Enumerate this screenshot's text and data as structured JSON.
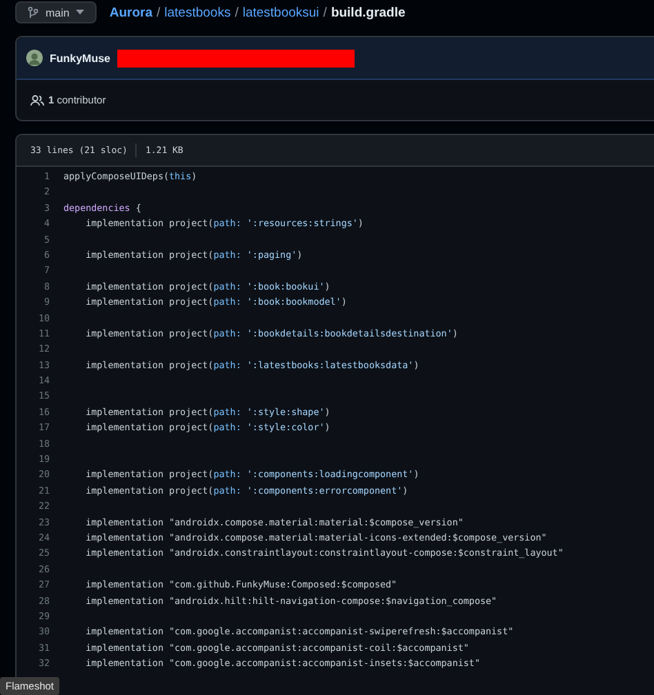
{
  "branch": {
    "label": "main"
  },
  "breadcrumb": [
    {
      "label": "Aurora",
      "kind": "repo"
    },
    {
      "label": "/",
      "kind": "separator"
    },
    {
      "label": "latestbooks",
      "kind": "dir"
    },
    {
      "label": "/",
      "kind": "separator"
    },
    {
      "label": "latestbooksui",
      "kind": "dir"
    },
    {
      "label": "/",
      "kind": "separator"
    },
    {
      "label": "build.gradle",
      "kind": "file"
    }
  ],
  "commit": {
    "author": "FunkyMuse"
  },
  "contributors": {
    "text": "**1** contributor"
  },
  "file_info": {
    "lines": "33 lines (21 sloc)",
    "size": "1.21 KB"
  },
  "code": [
    {
      "number": "1",
      "tokens": [
        {
          "t": "applyComposeUIDeps(",
          "kind": "plain"
        },
        {
          "t": "this",
          "kind": "keyword"
        },
        {
          "t": ")",
          "kind": "plain"
        }
      ]
    },
    {
      "number": "2"
    },
    {
      "number": "3",
      "tokens": [
        {
          "t": "dependencies",
          "kind": "entity"
        },
        {
          "t": " {",
          "kind": "plain"
        }
      ]
    },
    {
      "number": "4",
      "tokens": [
        {
          "t": "    implementation project(",
          "kind": "plain"
        },
        {
          "t": "path:",
          "kind": "keyword"
        },
        {
          "t": " ':resources:strings'",
          "kind": "string"
        },
        {
          "t": ")",
          "kind": "plain"
        }
      ]
    },
    {
      "number": "5"
    },
    {
      "number": "6",
      "tokens": [
        {
          "t": "    implementation project(",
          "kind": "plain"
        },
        {
          "t": "path:",
          "kind": "keyword"
        },
        {
          "t": " ':paging'",
          "kind": "string"
        },
        {
          "t": ")",
          "kind": "plain"
        }
      ]
    },
    {
      "number": "7"
    },
    {
      "number": "8",
      "tokens": [
        {
          "t": "    implementation project(",
          "kind": "plain"
        },
        {
          "t": "path:",
          "kind": "keyword"
        },
        {
          "t": " ':book:bookui'",
          "kind": "string"
        },
        {
          "t": ")",
          "kind": "plain"
        }
      ]
    },
    {
      "number": "9",
      "tokens": [
        {
          "t": "    implementation project(",
          "kind": "plain"
        },
        {
          "t": "path:",
          "kind": "keyword"
        },
        {
          "t": " ':book:bookmodel'",
          "kind": "string"
        },
        {
          "t": ")",
          "kind": "plain"
        }
      ]
    },
    {
      "number": "10"
    },
    {
      "number": "11",
      "tokens": [
        {
          "t": "    implementation project(",
          "kind": "plain"
        },
        {
          "t": "path:",
          "kind": "keyword"
        },
        {
          "t": " ':bookdetails:bookdetailsdestination'",
          "kind": "string"
        },
        {
          "t": ")",
          "kind": "plain"
        }
      ]
    },
    {
      "number": "12"
    },
    {
      "number": "13",
      "tokens": [
        {
          "t": "    implementation project(",
          "kind": "plain"
        },
        {
          "t": "path:",
          "kind": "keyword"
        },
        {
          "t": " ':latestbooks:latestbooksdata'",
          "kind": "string"
        },
        {
          "t": ")",
          "kind": "plain"
        }
      ]
    },
    {
      "number": "14"
    },
    {
      "number": "15"
    },
    {
      "number": "16",
      "tokens": [
        {
          "t": "    implementation project(",
          "kind": "plain"
        },
        {
          "t": "path:",
          "kind": "keyword"
        },
        {
          "t": " ':style:shape'",
          "kind": "string"
        },
        {
          "t": ")",
          "kind": "plain"
        }
      ]
    },
    {
      "number": "17",
      "tokens": [
        {
          "t": "    implementation project(",
          "kind": "plain"
        },
        {
          "t": "path:",
          "kind": "keyword"
        },
        {
          "t": " ':style:color'",
          "kind": "string"
        },
        {
          "t": ")",
          "kind": "plain"
        }
      ]
    },
    {
      "number": "18"
    },
    {
      "number": "19"
    },
    {
      "number": "20",
      "tokens": [
        {
          "t": "    implementation project(",
          "kind": "plain"
        },
        {
          "t": "path:",
          "kind": "keyword"
        },
        {
          "t": " ':components:loadingcomponent'",
          "kind": "string"
        },
        {
          "t": ")",
          "kind": "plain"
        }
      ]
    },
    {
      "number": "21",
      "tokens": [
        {
          "t": "    implementation project(",
          "kind": "plain"
        },
        {
          "t": "path:",
          "kind": "keyword"
        },
        {
          "t": " ':components:errorcomponent'",
          "kind": "string"
        },
        {
          "t": ")",
          "kind": "plain"
        }
      ]
    },
    {
      "number": "22"
    },
    {
      "number": "23",
      "tokens": [
        {
          "t": "    implementation \"androidx.compose.material:material:$compose_version\"",
          "kind": "plain"
        }
      ]
    },
    {
      "number": "24",
      "tokens": [
        {
          "t": "    implementation \"androidx.compose.material:material-icons-extended:$compose_version\"",
          "kind": "plain"
        }
      ]
    },
    {
      "number": "25",
      "tokens": [
        {
          "t": "    implementation \"androidx.constraintlayout:constraintlayout-compose:$constraint_layout\"",
          "kind": "plain"
        }
      ]
    },
    {
      "number": "26"
    },
    {
      "number": "27",
      "tokens": [
        {
          "t": "    implementation \"com.github.FunkyMuse:Composed:$composed\"",
          "kind": "plain"
        }
      ]
    },
    {
      "number": "28",
      "tokens": [
        {
          "t": "    implementation \"androidx.hilt:hilt-navigation-compose:$navigation_compose\"",
          "kind": "plain"
        }
      ]
    },
    {
      "number": "29"
    },
    {
      "number": "30",
      "tokens": [
        {
          "t": "    implementation \"com.google.accompanist:accompanist-swiperefresh:$accompanist\"",
          "kind": "plain"
        }
      ]
    },
    {
      "number": "31",
      "tokens": [
        {
          "t": "    implementation \"com.google.accompanist:accompanist-coil:$accompanist\"",
          "kind": "plain"
        }
      ]
    },
    {
      "number": "32",
      "tokens": [
        {
          "t": "    implementation \"com.google.accompanist:accompanist-insets:$accompanist\"",
          "kind": "plain"
        }
      ]
    }
  ],
  "tooltip": {
    "text": "Flameshot"
  }
}
